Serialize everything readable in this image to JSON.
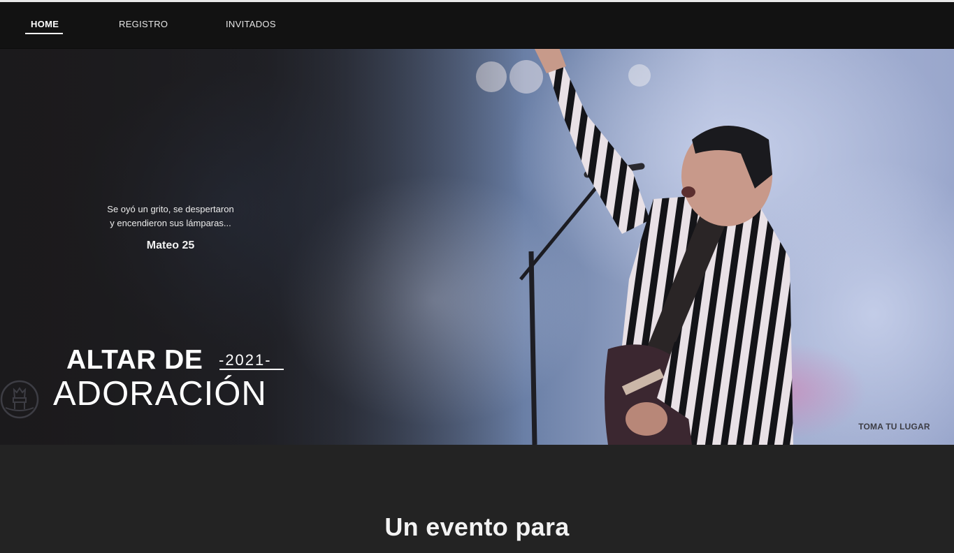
{
  "nav": {
    "items": [
      {
        "label": "HOME",
        "active": true
      },
      {
        "label": "REGISTRO",
        "active": false
      },
      {
        "label": "INVITADOS",
        "active": false
      }
    ]
  },
  "hero": {
    "quote_line1": "Se oyó un grito, se despertaron",
    "quote_line2": "y encendieron sus lámparas...",
    "quote_reference": "Mateo 25",
    "title_line1": "ALTAR DE",
    "title_year": "-2021-",
    "title_line2": "ADORACIÓN",
    "logo_icon": "throne-icon",
    "logo_text": "TOMA TU LUGAR"
  },
  "section": {
    "heading": "Un evento para"
  },
  "colors": {
    "background": "#232323",
    "navbar": "#121212",
    "text": "#ffffff",
    "logo": "#3d3d44"
  }
}
